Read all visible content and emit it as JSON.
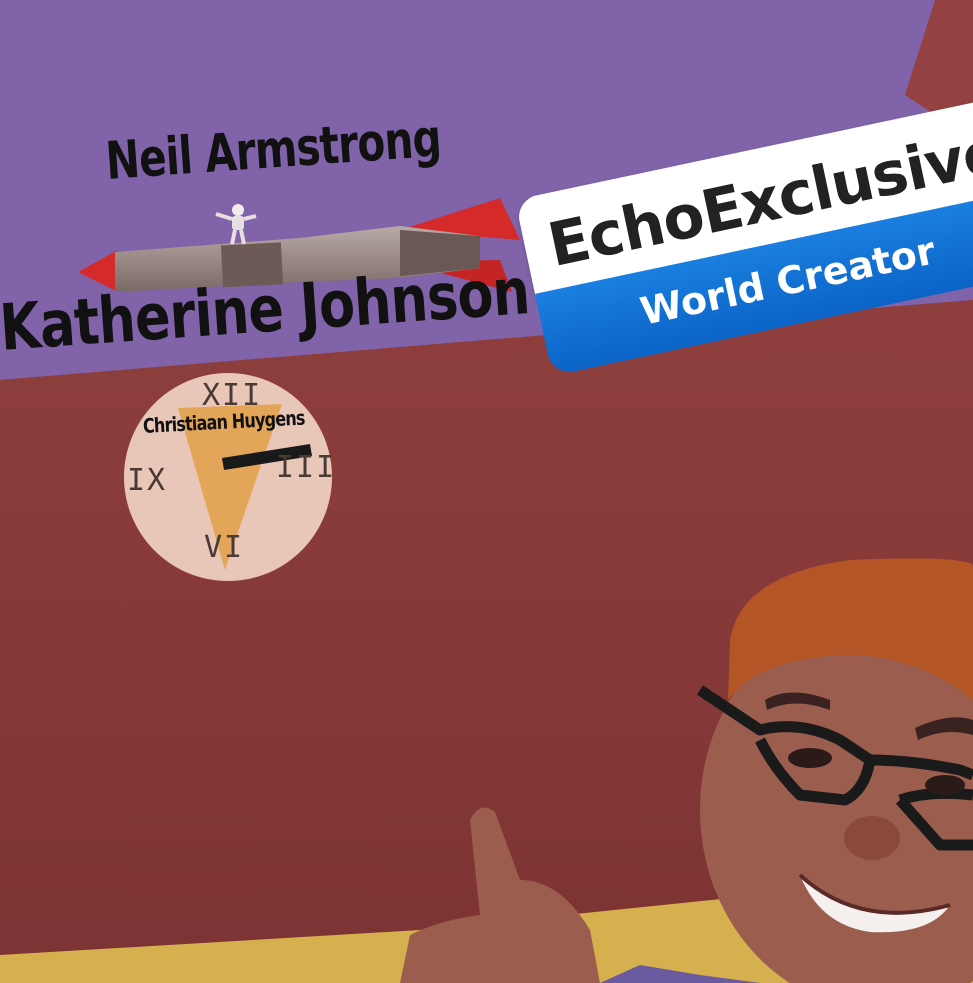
{
  "scene": {
    "labels": {
      "top": "Neil Armstrong",
      "middle": "Katherine Johnson",
      "clock": "Christiaan Huygens"
    },
    "clock_numerals": {
      "twelve": "XII",
      "three": "III",
      "six": "VI",
      "nine": "IX"
    }
  },
  "nametag": {
    "username": "EchoExclusive",
    "role": "World Creator"
  },
  "colors": {
    "wall_top": "#8063a9",
    "wall_bottom": "#8a3d3b",
    "floor": "#d6b04e",
    "tag_blue": "#1a7fe0",
    "rocket_red": "#d42a2a"
  }
}
